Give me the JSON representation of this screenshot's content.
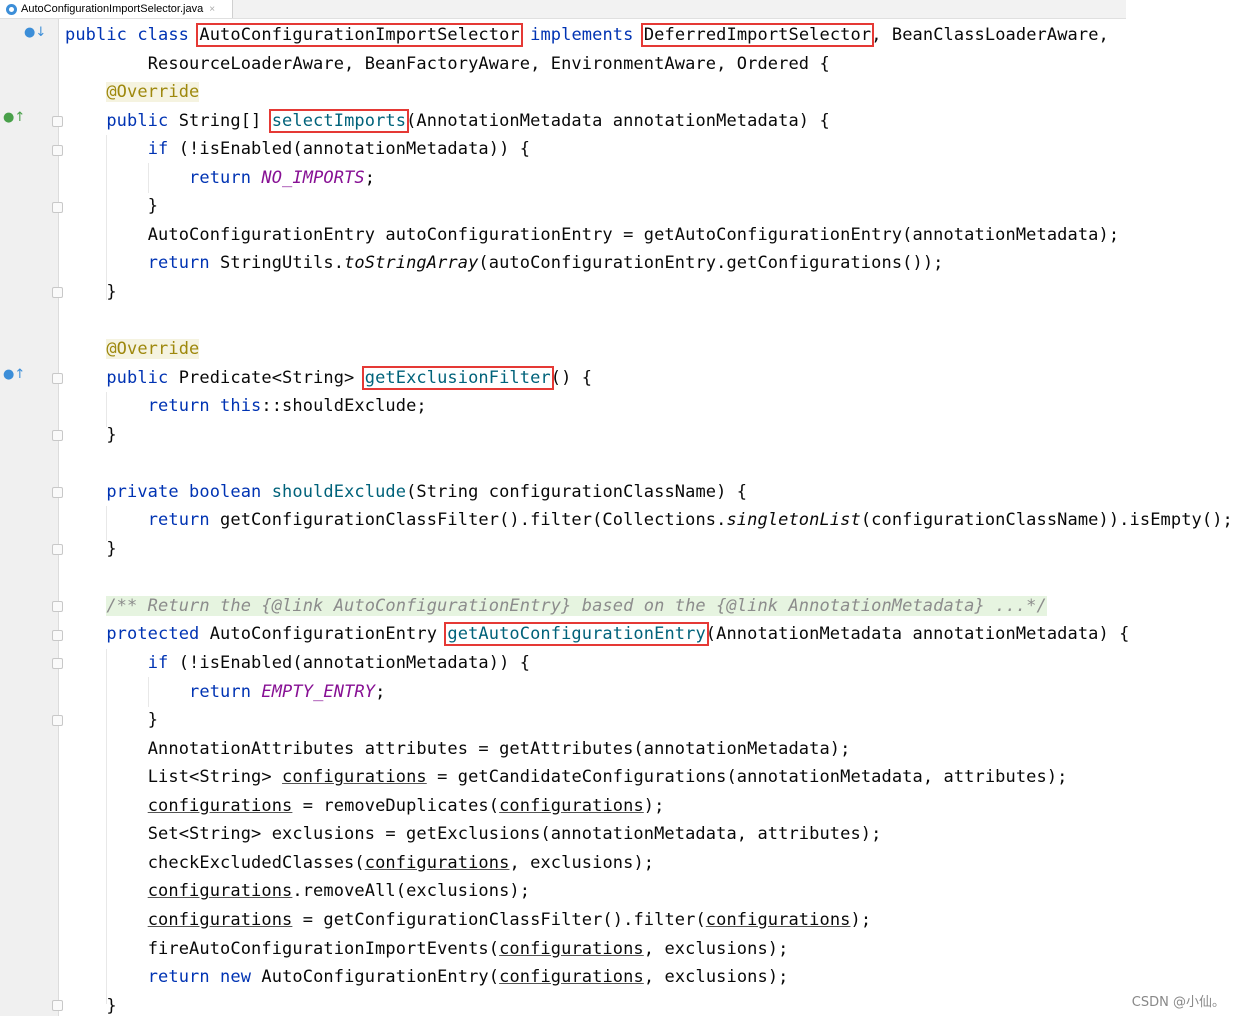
{
  "tab": {
    "filename": "AutoConfigurationImportSelector.java",
    "close": "×"
  },
  "code": {
    "l1": {
      "kw1": "public class",
      "cls": "AutoConfigurationImportSelector",
      "kw2": "implements",
      "iface": "DeferredImportSelector",
      "rest": ", BeanClassLoaderAware,"
    },
    "l2": "ResourceLoaderAware, BeanFactoryAware, EnvironmentAware, Ordered {",
    "l3": "@Override",
    "l4": {
      "kw": "public",
      "t": " String[] ",
      "fn": "selectImports",
      "rest": "(AnnotationMetadata annotationMetadata) {"
    },
    "l5": {
      "kw": "if",
      "rest": " (!isEnabled(annotationMetadata)) {"
    },
    "l6": {
      "kw": "return",
      "c": "NO_IMPORTS",
      "rest": ";"
    },
    "l7": "}",
    "l8": "AutoConfigurationEntry autoConfigurationEntry = getAutoConfigurationEntry(annotationMetadata);",
    "l9": {
      "kw": "return",
      "a": " StringUtils.",
      "i": "toStringArray",
      "rest": "(autoConfigurationEntry.getConfigurations());"
    },
    "l10": "}",
    "l12": "@Override",
    "l13": {
      "kw": "public",
      "t": " Predicate<String> ",
      "fn": "getExclusionFilter",
      "rest": "() {"
    },
    "l14": {
      "kw1": "return",
      "kw2": "this",
      "rest": "::shouldExclude;"
    },
    "l15": "}",
    "l17": {
      "kw": "private boolean",
      "fn": "shouldExclude",
      "rest": "(String configurationClassName) {"
    },
    "l18": {
      "kw": "return",
      "a": " getConfigurationClassFilter().filter(Collections.",
      "i": "singletonList",
      "rest": "(configurationClassName)).isEmpty();"
    },
    "l19": "}",
    "l21": "/** Return the {@link AutoConfigurationEntry} based on the {@link AnnotationMetadata} ...*/",
    "l22": {
      "kw": "protected",
      "t": " AutoConfigurationEntry ",
      "fn": "getAutoConfigurationEntry",
      "rest": "(AnnotationMetadata annotationMetadata) {"
    },
    "l23": {
      "kw": "if",
      "rest": " (!isEnabled(annotationMetadata)) {"
    },
    "l24": {
      "kw": "return",
      "c": "EMPTY_ENTRY",
      "rest": ";"
    },
    "l25": "}",
    "l26": "AnnotationAttributes attributes = getAttributes(annotationMetadata);",
    "l27": {
      "a": "List<String> ",
      "u": "configurations",
      "rest": " = getCandidateConfigurations(annotationMetadata, attributes);"
    },
    "l28": {
      "u1": "configurations",
      "mid": " = removeDuplicates(",
      "u2": "configurations",
      "rest": ");"
    },
    "l29": "Set<String> exclusions = getExclusions(annotationMetadata, attributes);",
    "l30": {
      "a": "checkExcludedClasses(",
      "u": "configurations",
      "rest": ", exclusions);"
    },
    "l31": {
      "u": "configurations",
      "rest": ".removeAll(exclusions);"
    },
    "l32": {
      "u1": "configurations",
      "mid": " = getConfigurationClassFilter().filter(",
      "u2": "configurations",
      "rest": ");"
    },
    "l33": {
      "a": "fireAutoConfigurationImportEvents(",
      "u": "configurations",
      "rest": ", exclusions);"
    },
    "l34": {
      "kw1": "return",
      "kw2": "new",
      "a": " AutoConfigurationEntry(",
      "u": "configurations",
      "rest": ", exclusions);"
    },
    "l35": "}"
  },
  "watermark": "CSDN @小仙。"
}
